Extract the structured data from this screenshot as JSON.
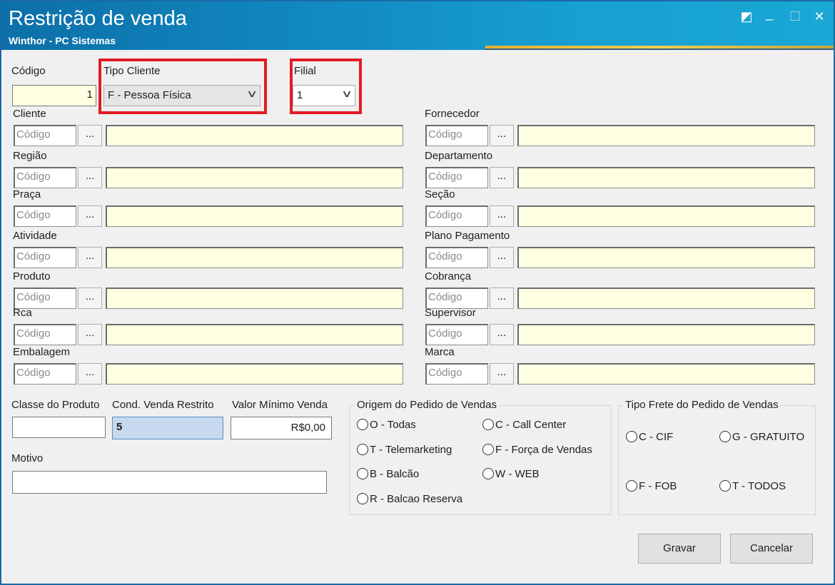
{
  "window": {
    "title": "Restrição de venda",
    "subtitle": "Winthor - PC Sistemas",
    "controls": {
      "restore": "◩",
      "minimize": "_",
      "maximize": "☐",
      "close": "✕"
    }
  },
  "codigo": {
    "label": "Código",
    "value": "1"
  },
  "tipo_cliente": {
    "label": "Tipo Cliente",
    "value": "F - Pessoa Física"
  },
  "filial": {
    "label": "Filial",
    "value": "1"
  },
  "lookup_placeholder": "Código",
  "lookup_button": "...",
  "left_fields": [
    {
      "label": "Cliente"
    },
    {
      "label": "Região"
    },
    {
      "label": "Praça"
    },
    {
      "label": "Atividade"
    },
    {
      "label": "Produto"
    },
    {
      "label": "Rca"
    },
    {
      "label": "Embalagem"
    }
  ],
  "right_fields": [
    {
      "label": "Fornecedor"
    },
    {
      "label": "Departamento"
    },
    {
      "label": "Seção"
    },
    {
      "label": "Plano Pagamento"
    },
    {
      "label": "Cobrança"
    },
    {
      "label": "Supervisor"
    },
    {
      "label": "Marca"
    }
  ],
  "classe_produto": {
    "label": "Classe do Produto",
    "value": ""
  },
  "cond_venda": {
    "label": "Cond. Venda Restrito",
    "value": "5"
  },
  "valor_minimo": {
    "label": "Valor Mínimo Venda",
    "value": "R$0,00"
  },
  "motivo": {
    "label": "Motivo",
    "value": ""
  },
  "origem": {
    "title": "Origem do Pedido de Vendas",
    "options": [
      "O - Todas",
      "C - Call Center",
      "T - Telemarketing",
      "F - Força de Vendas",
      "B - Balcão",
      "W - WEB",
      "R - Balcao Reserva"
    ]
  },
  "frete": {
    "title": "Tipo Frete do Pedido de Vendas",
    "options": [
      "C - CIF",
      "G - GRATUITO",
      "F - FOB",
      "T - TODOS"
    ]
  },
  "buttons": {
    "save": "Gravar",
    "cancel": "Cancelar"
  },
  "colors": {
    "highlight_border": "#e31b23",
    "input_yellow": "#ffffe1",
    "title_bar": "#1187bf"
  }
}
